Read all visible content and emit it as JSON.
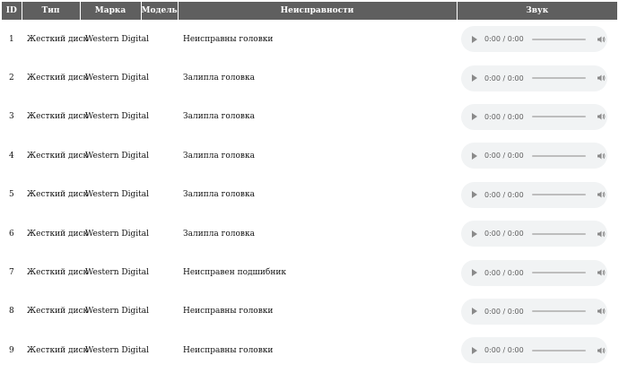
{
  "table": {
    "headers": {
      "id": "ID",
      "type": "Тип",
      "brand": "Марка",
      "model": "Модель",
      "fault": "Неисправности",
      "sound": "Звук"
    },
    "rows": [
      {
        "id": "1",
        "type": "Жесткий диск",
        "brand": "Western Digital",
        "model": "",
        "fault": "Неисправны головки",
        "time": "0:00 / 0:00"
      },
      {
        "id": "2",
        "type": "Жесткий диск",
        "brand": "Western Digital",
        "model": "",
        "fault": "Залипла головка",
        "time": "0:00 / 0:00"
      },
      {
        "id": "3",
        "type": "Жесткий диск",
        "brand": "Western Digital",
        "model": "",
        "fault": "Залипла головка",
        "time": "0:00 / 0:00"
      },
      {
        "id": "4",
        "type": "Жесткий диск",
        "brand": "Western Digital",
        "model": "",
        "fault": "Залипла головка",
        "time": "0:00 / 0:00"
      },
      {
        "id": "5",
        "type": "Жесткий диск",
        "brand": "Western Digital",
        "model": "",
        "fault": "Залипла головка",
        "time": "0:00 / 0:00"
      },
      {
        "id": "6",
        "type": "Жесткий диск",
        "brand": "Western Digital",
        "model": "",
        "fault": "Залипла головка",
        "time": "0:00 / 0:00"
      },
      {
        "id": "7",
        "type": "Жесткий диск",
        "brand": "Western Digital",
        "model": "",
        "fault": "Неисправен подшибник",
        "time": "0:00 / 0:00"
      },
      {
        "id": "8",
        "type": "Жесткий диск",
        "brand": "Western Digital",
        "model": "",
        "fault": "Неисправны головки",
        "time": "0:00 / 0:00"
      },
      {
        "id": "9",
        "type": "Жесткий диск",
        "brand": "Western Digital",
        "model": "",
        "fault": "Неисправны головки",
        "time": "0:00 / 0:00"
      }
    ]
  },
  "icons": {
    "play": "play-icon",
    "volume": "volume-icon"
  },
  "colors": {
    "header_bg": "#5f5f5f",
    "header_text": "#ffffff",
    "player_bg": "#f1f3f4"
  }
}
